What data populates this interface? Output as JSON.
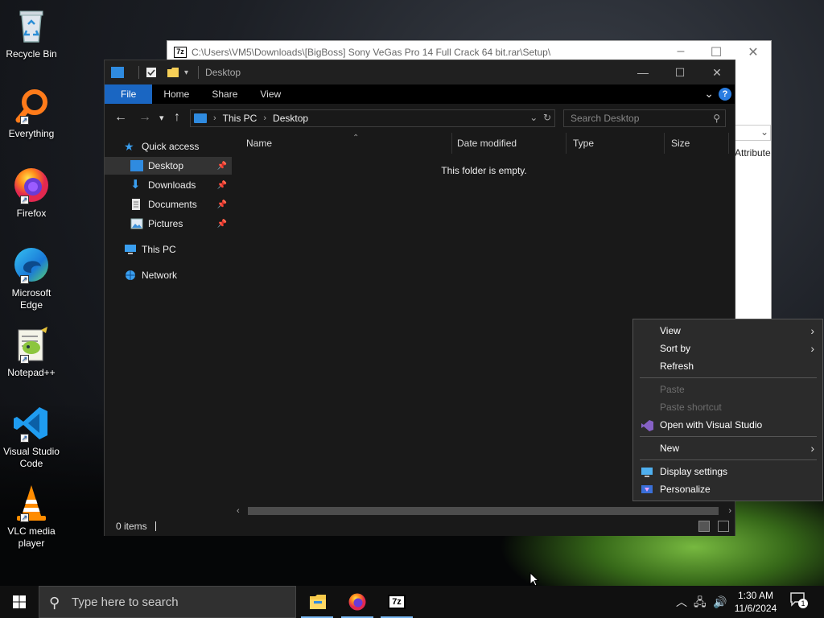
{
  "desktop": {
    "icons": [
      {
        "label": "Recycle Bin"
      },
      {
        "label": "Everything"
      },
      {
        "label": "Firefox"
      },
      {
        "label": "Microsoft Edge"
      },
      {
        "label": "Notepad++"
      },
      {
        "label": "Visual Studio Code"
      },
      {
        "label": "VLC media player"
      }
    ]
  },
  "bg_window": {
    "title": "C:\\Users\\VM5\\Downloads\\[BigBoss] Sony VeGas Pro 14 Full Crack 64 bit.rar\\Setup\\",
    "app_icon_text": "7z",
    "column_attributes": "Attribute"
  },
  "explorer": {
    "title": "Desktop",
    "ribbon_tabs": [
      "File",
      "Home",
      "Share",
      "View"
    ],
    "help_label": "?",
    "breadcrumb": [
      "This PC",
      "Desktop"
    ],
    "search_placeholder": "Search Desktop",
    "nav": {
      "quick_access": "Quick access",
      "desktop": "Desktop",
      "downloads": "Downloads",
      "documents": "Documents",
      "pictures": "Pictures",
      "this_pc": "This PC",
      "network": "Network"
    },
    "columns": [
      "Name",
      "Date modified",
      "Type",
      "Size"
    ],
    "empty_message": "This folder is empty.",
    "status_items": "0 items"
  },
  "context_menu": {
    "items": [
      {
        "label": "View",
        "submenu": true,
        "enabled": true
      },
      {
        "label": "Sort by",
        "submenu": true,
        "enabled": true
      },
      {
        "label": "Refresh",
        "enabled": true
      },
      {
        "label": "Paste",
        "enabled": false
      },
      {
        "label": "Paste shortcut",
        "enabled": false
      },
      {
        "label": "Open with Visual Studio",
        "enabled": true,
        "icon": "visual-studio-icon"
      },
      {
        "label": "New",
        "submenu": true,
        "enabled": true
      },
      {
        "label": "Display settings",
        "enabled": true,
        "icon": "display-icon"
      },
      {
        "label": "Personalize",
        "enabled": true,
        "icon": "personalize-icon"
      }
    ]
  },
  "taskbar": {
    "search_placeholder": "Type here to search",
    "apps": [
      "file-explorer",
      "firefox",
      "7-zip"
    ],
    "time": "1:30 AM",
    "date": "11/6/2024",
    "notification_count": "1"
  },
  "colors": {
    "accent": "#1a66c2",
    "explorer_bg": "#191919",
    "menu_bg": "#2b2b2b",
    "taskbar_bg": "#101010"
  }
}
